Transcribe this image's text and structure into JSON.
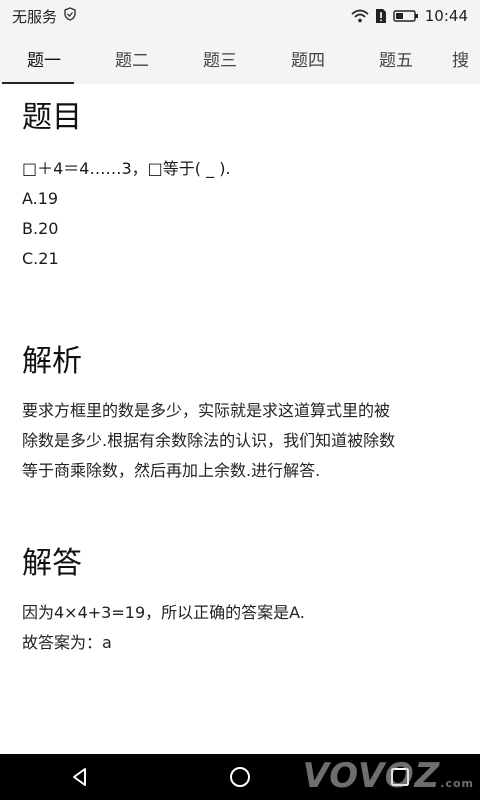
{
  "status_bar": {
    "carrier": "无服务",
    "time": "10:44"
  },
  "tabs": [
    {
      "label": "题一",
      "active": true
    },
    {
      "label": "题二"
    },
    {
      "label": "题三"
    },
    {
      "label": "题四"
    },
    {
      "label": "题五"
    },
    {
      "label": "搜"
    }
  ],
  "question": {
    "heading": "题目",
    "stem": "□＋4＝4……3，□等于( _ ).",
    "options": [
      "A.19",
      "B.20",
      "C.21"
    ]
  },
  "analysis": {
    "heading": "解析",
    "lines": [
      "要求方框里的数是多少，实际就是求这道算式里的被",
      "除数是多少.根据有余数除法的认识，我们知道被除数",
      "等于商乘除数，然后再加上余数.进行解答."
    ]
  },
  "answer": {
    "heading": "解答",
    "lines": [
      "因为4×4+3=19，所以正确的答案是A.",
      "故答案为：a"
    ]
  },
  "watermark": {
    "text": "VOVOZ",
    "suffix": ".com"
  }
}
